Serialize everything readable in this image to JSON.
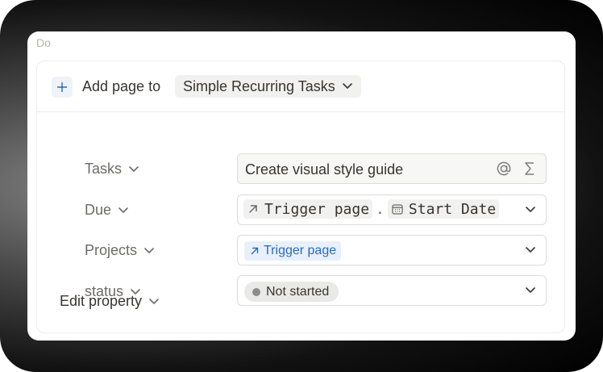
{
  "section_title": "Do",
  "add_row": {
    "plus_icon": "plus-icon",
    "label": "Add page to",
    "database": "Simple Recurring Tasks"
  },
  "properties": {
    "tasks": {
      "label": "Tasks",
      "value": "Create visual style guide",
      "icons": [
        "at-mention-icon",
        "sigma-icon"
      ]
    },
    "due": {
      "label": "Due",
      "parts": [
        {
          "icon": "arrow-up-right-icon",
          "text": "Trigger page"
        },
        {
          "separator": "."
        },
        {
          "icon": "calendar-icon",
          "text": "Start Date"
        }
      ],
      "part1": "Trigger page",
      "separator": ".",
      "part2": "Start Date"
    },
    "projects": {
      "label": "Projects",
      "chip": "Trigger page"
    },
    "status": {
      "label": "status",
      "pill": "Not started"
    }
  },
  "edit_property": "Edit property",
  "colors": {
    "accent_blue": "#2c6bb5",
    "chip_blue_bg": "#e7f0fb",
    "text": "#37352f",
    "muted": "#6b6b68"
  }
}
